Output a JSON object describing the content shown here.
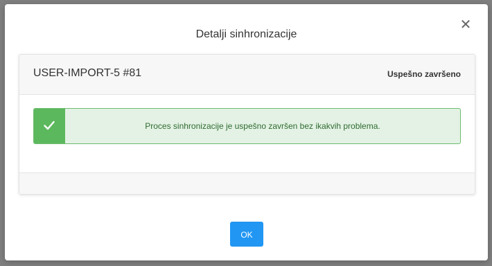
{
  "modal": {
    "title": "Detalji sinhronizacije",
    "close_glyph": "✕",
    "ok_label": "OK"
  },
  "job": {
    "name": "USER-IMPORT-5 #81",
    "status": "Uspešno završeno"
  },
  "alert": {
    "icon": "check-icon",
    "message": "Proces sinhronizacije je uspešno završen bez ikakvih problema."
  },
  "colors": {
    "accent": "#2196f3",
    "success": "#5cb85c",
    "success_bg": "#e3f2e4"
  }
}
